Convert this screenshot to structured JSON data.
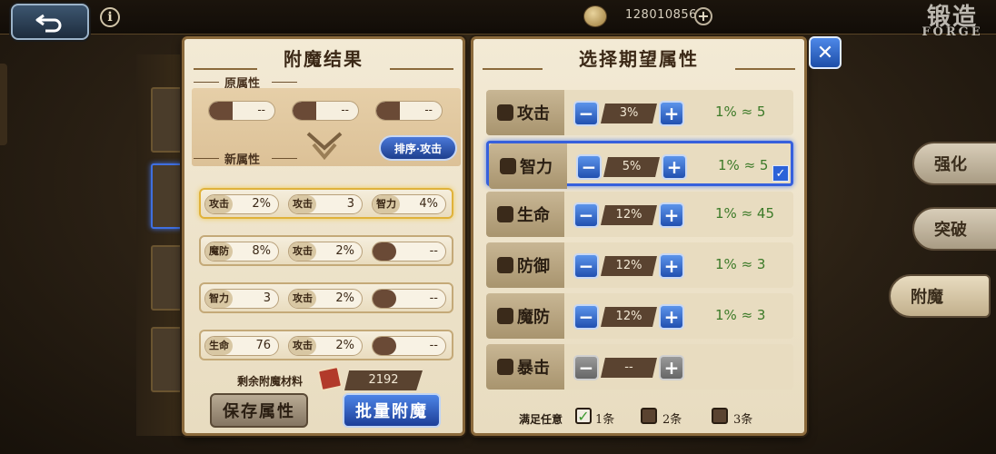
{
  "topbar": {
    "coins": "128010856",
    "info_label": "i",
    "coin_plus": "+",
    "logo_cn": "锻造",
    "logo_en": "FORGE"
  },
  "result_panel": {
    "title": "附魔结果",
    "orig_label": "原属性",
    "orig_slots": [
      "--",
      "--",
      "--"
    ],
    "new_label": "新属性",
    "sort_label": "排序·攻击",
    "rows": [
      {
        "attrs": [
          {
            "name": "攻击",
            "value": "2%"
          },
          {
            "name": "攻击",
            "value": "3"
          },
          {
            "name": "智力",
            "value": "4%"
          }
        ],
        "selected": true
      },
      {
        "attrs": [
          {
            "name": "魔防",
            "value": "8%"
          },
          {
            "name": "攻击",
            "value": "2%"
          },
          {
            "name": "",
            "value": "--"
          }
        ],
        "selected": false
      },
      {
        "attrs": [
          {
            "name": "智力",
            "value": "3"
          },
          {
            "name": "攻击",
            "value": "2%"
          },
          {
            "name": "",
            "value": "--"
          }
        ],
        "selected": false
      },
      {
        "attrs": [
          {
            "name": "生命",
            "value": "76"
          },
          {
            "name": "攻击",
            "value": "2%"
          },
          {
            "name": "",
            "value": "--"
          }
        ],
        "selected": false
      }
    ],
    "material_label": "剩余附魔材料",
    "material_value": "2192",
    "save_label": "保存属性",
    "batch_label": "批量附魔"
  },
  "select_panel": {
    "title": "选择期望属性",
    "choices": [
      {
        "name": "攻击",
        "pct": "3%",
        "ratio": "1% ≈ 5",
        "selected": false,
        "disabled": false
      },
      {
        "name": "智力",
        "pct": "5%",
        "ratio": "1% ≈ 5",
        "selected": true,
        "disabled": false
      },
      {
        "name": "生命",
        "pct": "12%",
        "ratio": "1% ≈ 45",
        "selected": false,
        "disabled": false
      },
      {
        "name": "防御",
        "pct": "12%",
        "ratio": "1% ≈ 3",
        "selected": false,
        "disabled": false
      },
      {
        "name": "魔防",
        "pct": "12%",
        "ratio": "1% ≈ 3",
        "selected": false,
        "disabled": false
      },
      {
        "name": "暴击",
        "pct": "--",
        "ratio": "",
        "selected": false,
        "disabled": true
      }
    ],
    "condition_label": "满足任意",
    "condition_options": [
      {
        "label": "1条",
        "checked": true
      },
      {
        "label": "2条",
        "checked": false
      },
      {
        "label": "3条",
        "checked": false
      }
    ]
  },
  "side_tabs": [
    "强化",
    "突破",
    "附魔"
  ],
  "colors": {
    "accent": "#2c62d8",
    "panel_bg": "#f3ead5",
    "ratio_green": "#3c7a28"
  }
}
